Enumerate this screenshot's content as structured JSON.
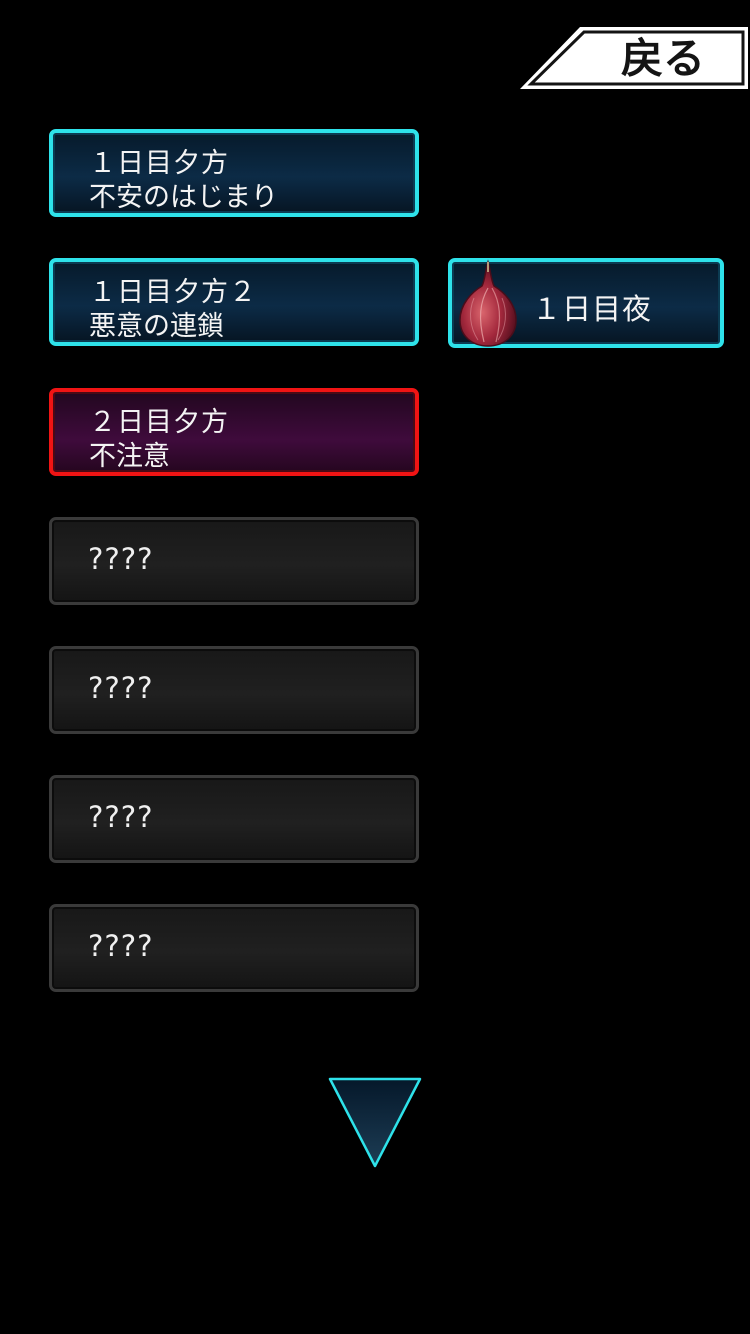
{
  "back_button": {
    "label": "戻る"
  },
  "chapters": [
    {
      "state": "cleared",
      "line1": "１日目夕方",
      "line2": "不安のはじまり"
    },
    {
      "state": "cleared",
      "line1": "１日目夕方２",
      "line2": "悪意の連鎖"
    },
    {
      "state": "current",
      "line1": "２日目夕方",
      "line2": "不注意"
    },
    {
      "state": "locked",
      "label": "????"
    },
    {
      "state": "locked",
      "label": "????"
    },
    {
      "state": "locked",
      "label": "????"
    },
    {
      "state": "locked",
      "label": "????"
    }
  ],
  "side_chapter": {
    "label": "１日目夜",
    "icon": "onion-icon"
  },
  "scroll": {
    "icon": "scroll-down-triangle-icon"
  },
  "colors": {
    "background": "#000000",
    "cleared_border": "#2ee2ea",
    "current_border": "#f01414",
    "locked_border": "#3a3a3a",
    "back_button_fill": "#ffffff"
  }
}
